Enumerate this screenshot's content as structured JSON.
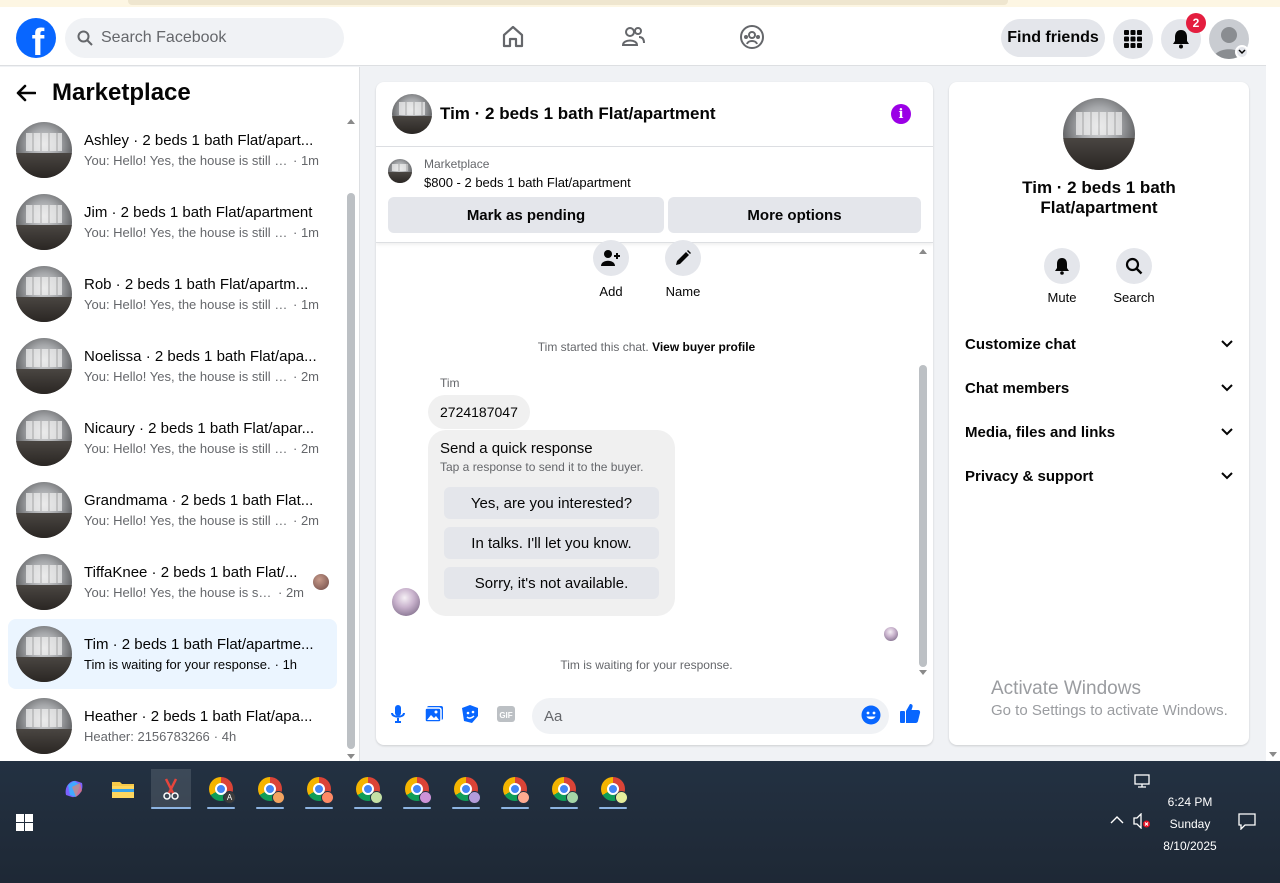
{
  "header": {
    "search_placeholder": "Search Facebook",
    "find_friends": "Find friends",
    "notif_count": "2"
  },
  "sidebar": {
    "title": "Marketplace",
    "conversations": [
      {
        "name": "Ashley · 2 beds 1 bath Flat/apart...",
        "msg": "You: Hello! Yes, the house is still av...",
        "time": "· 1m"
      },
      {
        "name": "Jim · 2 beds 1 bath Flat/apartment",
        "msg": "You: Hello! Yes, the house is still av...",
        "time": "· 1m"
      },
      {
        "name": "Rob · 2 beds 1 bath Flat/apartm...",
        "msg": "You: Hello! Yes, the house is still av...",
        "time": "· 1m"
      },
      {
        "name": "Noelissa · 2 beds 1 bath Flat/apa...",
        "msg": "You: Hello! Yes, the house is still av...",
        "time": "· 2m"
      },
      {
        "name": "Nicaury · 2 beds 1 bath Flat/apar...",
        "msg": "You: Hello! Yes, the house is still av...",
        "time": "· 2m"
      },
      {
        "name": "Grandmama · 2 beds 1 bath Flat...",
        "msg": "You: Hello! Yes, the house is still av...",
        "time": "· 2m"
      },
      {
        "name": "TiffaKnee · 2 beds 1 bath Flat/...",
        "msg": "You: Hello! Yes, the house is still...",
        "time": "· 2m"
      },
      {
        "name": "Tim · 2 beds 1 bath Flat/apartme...",
        "msg": "Tim is waiting for your response.",
        "time": "· 1h"
      },
      {
        "name": "Heather · 2 beds 1 bath Flat/apa...",
        "msg": "Heather: 2156783266",
        "time": "· 4h"
      }
    ]
  },
  "chat": {
    "title": "Tim · 2 beds 1 bath Flat/apartment",
    "info_glyph": "i",
    "marketplace_label": "Marketplace",
    "listing": "$800 - 2 beds 1 bath Flat/apartment",
    "mark_pending": "Mark as pending",
    "more_options": "More options",
    "add_label": "Add",
    "name_label": "Name",
    "started_text": "Tim started this chat.",
    "view_profile": "View buyer profile",
    "sender": "Tim",
    "phone_message": "2724187047",
    "quick_title": "Send a quick response",
    "quick_sub": "Tap a response to send it to the buyer.",
    "quick_replies": [
      "Yes, are you interested?",
      "In talks. I'll let you know.",
      "Sorry, it's not available."
    ],
    "waiting": "Tim is waiting for your response.",
    "input_placeholder": "Aa",
    "gif_label": "GIF"
  },
  "info_panel": {
    "name": "Tim · 2 beds 1 bath Flat/apartment",
    "mute": "Mute",
    "search": "Search",
    "sections": [
      "Customize chat",
      "Chat members",
      "Media, files and links",
      "Privacy & support"
    ]
  },
  "watermark": {
    "line1": "Activate Windows",
    "line2": "Go to Settings to activate Windows."
  },
  "taskbar": {
    "time": "6:24 PM",
    "day": "Sunday",
    "date": "8/10/2025"
  },
  "colors": {
    "brand": "#0866ff",
    "accent_purple": "#9b00e6",
    "badge_red": "#e41e3f",
    "active_row": "#ebf5ff"
  }
}
